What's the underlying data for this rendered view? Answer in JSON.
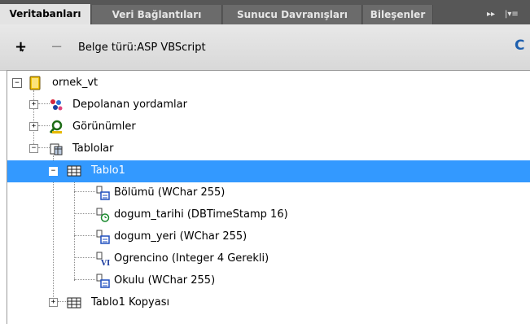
{
  "tabs": [
    {
      "label": "Veritabanları",
      "active": true
    },
    {
      "label": "Veri Bağlantıları",
      "active": false
    },
    {
      "label": "Sunucu Davranışları",
      "active": false
    },
    {
      "label": "Bileşenler",
      "active": false
    }
  ],
  "tab_controls": {
    "scroll": "▸▸",
    "menu": "|▾≡"
  },
  "toolbar": {
    "add_symbol": "+",
    "add_caret": "▾",
    "remove_symbol": "−",
    "doc_type": "Belge türü:ASP VBScript",
    "refresh_symbol": "C"
  },
  "tree": {
    "root": {
      "label": "ornek_vt",
      "expanded": true,
      "icon": "database-icon"
    },
    "stored_procedures": {
      "label": "Depolanan yordamlar",
      "icon": "stored-procedure-icon"
    },
    "views": {
      "label": "Görünümler",
      "icon": "view-icon"
    },
    "tables": {
      "label": "Tablolar",
      "icon": "table-folder-icon"
    },
    "table1": {
      "label": "Tablo1",
      "selected": true,
      "icon": "table-grid-icon"
    },
    "columns": [
      {
        "label": "Bölümü (WChar 255)",
        "icon": "text-column-icon"
      },
      {
        "label": "dogum_tarihi (DBTimeStamp 16)",
        "icon": "date-column-icon"
      },
      {
        "label": "dogum_yeri (WChar 255)",
        "icon": "text-column-icon"
      },
      {
        "label": "Ogrencino (Integer 4 Gerekli)",
        "icon": "integer-column-icon"
      },
      {
        "label": "Okulu (WChar 255)",
        "icon": "text-column-icon"
      }
    ],
    "table1_copy": {
      "label": "Tablo1 Kopyası",
      "icon": "table-grid-icon"
    },
    "expand_symbol": "+",
    "collapse_symbol": "−"
  },
  "colors": {
    "selection": "#3399ff",
    "tab_bar": "#575757",
    "active_tab": "#e3e3e3"
  }
}
